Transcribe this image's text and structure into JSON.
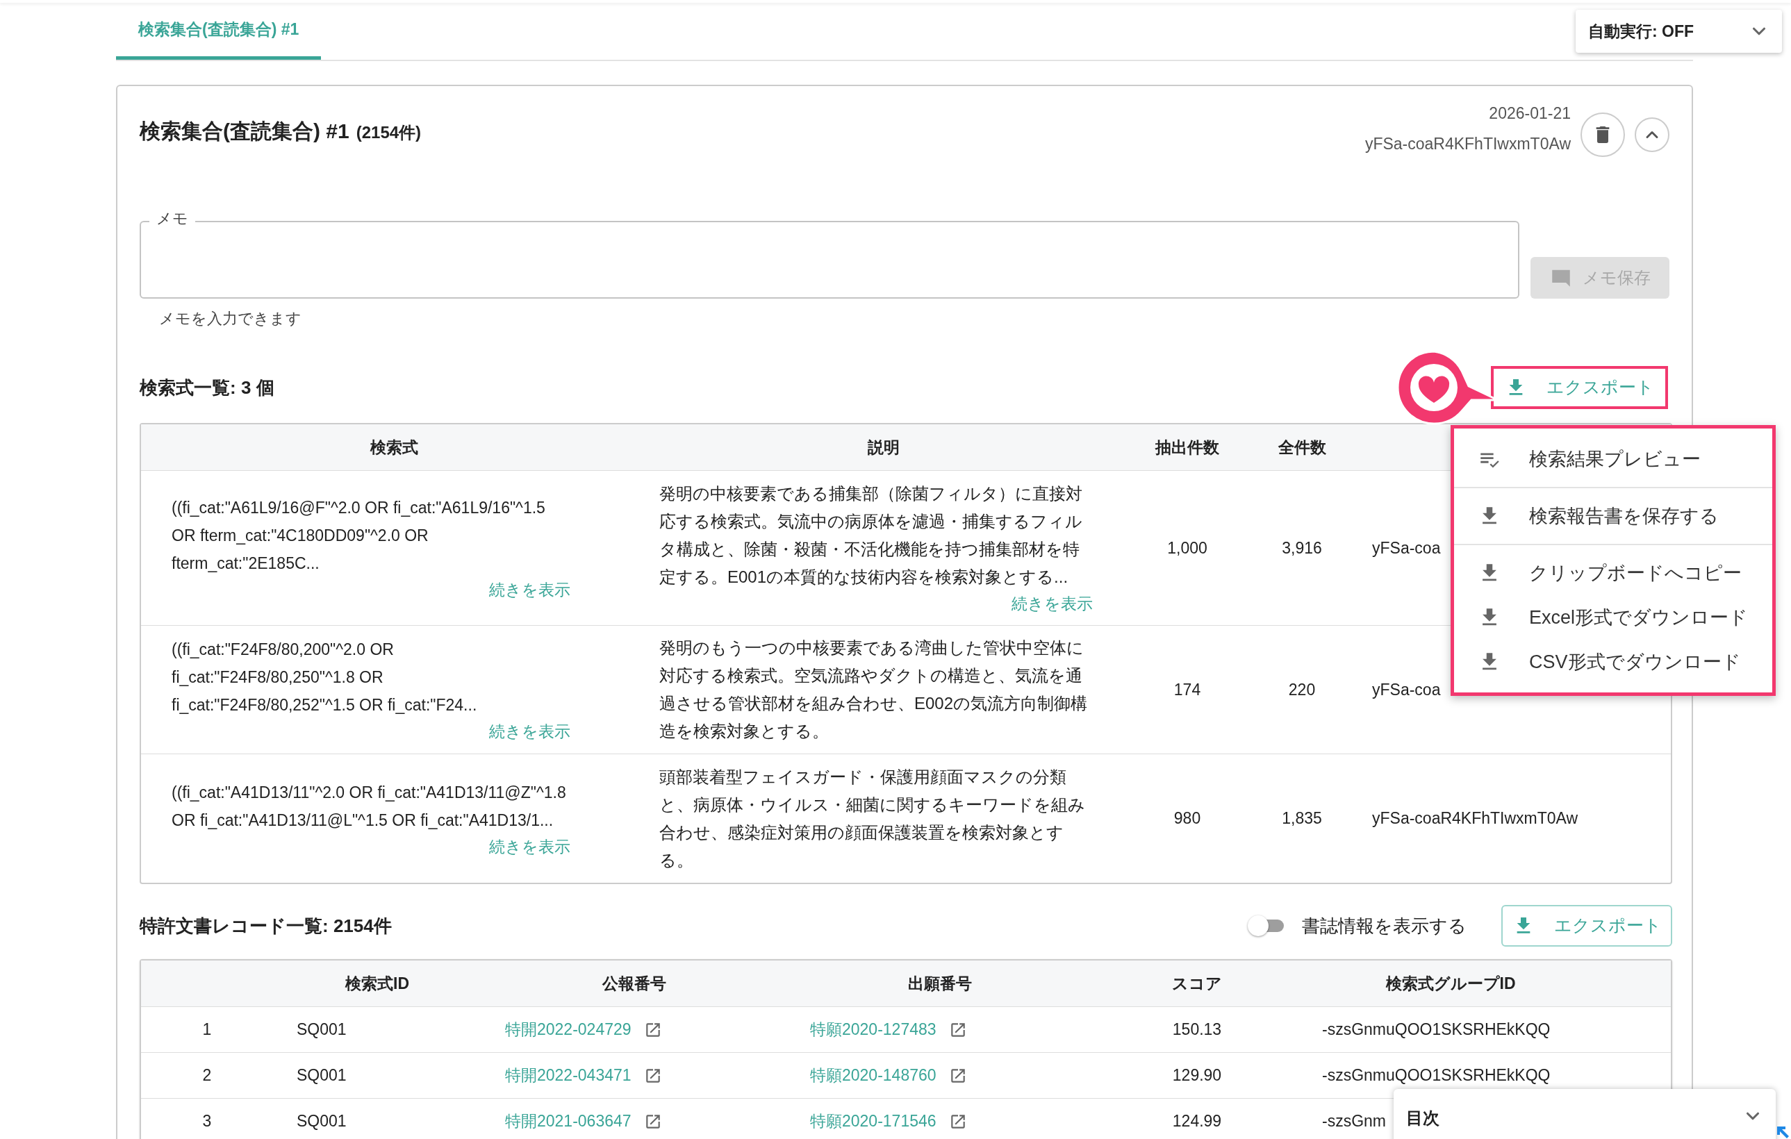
{
  "tabs": [
    {
      "label": "検索集合(査読集合) #1",
      "selected": true
    }
  ],
  "auto_run": {
    "label": "自動実行: OFF",
    "expanded": false
  },
  "card": {
    "title": "検索集合(査読集合) #1",
    "count": "(2154件)",
    "date": "2026-01-21",
    "id": "yFSa-coaR4KFhTIwxmT0Aw",
    "expanded": true
  },
  "memo": {
    "label": "メモ",
    "helper": "メモを入力できます",
    "save_button": "メモ保存",
    "save_disabled": true
  },
  "queries": {
    "heading": "検索式一覧: 3 個",
    "export_button": "エクスポート",
    "columns": [
      "検索式",
      "説明",
      "抽出件数",
      "全件数"
    ],
    "rows": [
      {
        "query": "((fi_cat:\"A61L9/16@F\"^2.0 OR fi_cat:\"A61L9/16\"^1.5 OR fterm_cat:\"4C180DD09\"^2.0 OR fterm_cat:\"2E185C...",
        "query_more": "続きを表示",
        "description": "発明の中核要素である捕集部（除菌フィルタ）に直接対応する検索式。気流中の病原体を濾過・捕集するフィルタ構成と、除菌・殺菌・不活化機能を持つ捕集部材を特定する。E001の本質的な技術内容を検索対象とする...",
        "description_more": "続きを表示",
        "extracted": "1,000",
        "total": "3,916",
        "group": "yFSa-coa"
      },
      {
        "query": "((fi_cat:\"F24F8/80,200\"^2.0 OR fi_cat:\"F24F8/80,250\"^1.8 OR fi_cat:\"F24F8/80,252\"^1.5 OR fi_cat:\"F24...",
        "query_more": "続きを表示",
        "description": "発明のもう一つの中核要素である湾曲した管状中空体に対応する検索式。空気流路やダクトの構造と、気流を通過させる管状部材を組み合わせ、E002の気流方向制御構造を検索対象とする。",
        "extracted": "174",
        "total": "220",
        "group": "yFSa-coa"
      },
      {
        "query": "((fi_cat:\"A41D13/11\"^2.0 OR fi_cat:\"A41D13/11@Z\"^1.8 OR fi_cat:\"A41D13/11@L\"^1.5 OR fi_cat:\"A41D13/1...",
        "query_more": "続きを表示",
        "description": "頭部装着型フェイスガード・保護用顔面マスクの分類と、病原体・ウイルス・細菌に関するキーワードを組み合わせ、感染症対策用の顔面保護装置を検索対象とする。",
        "extracted": "980",
        "total": "1,835",
        "group": "yFSa-coaR4KFhTIwxmT0Aw"
      }
    ]
  },
  "export_menu": {
    "groups": [
      [
        {
          "label": "検索結果プレビュー",
          "kind": "preview"
        }
      ],
      [
        {
          "label": "検索報告書を保存する",
          "kind": "download"
        }
      ],
      [
        {
          "label": "クリップボードへコピー",
          "kind": "download"
        },
        {
          "label": "Excel形式でダウンロード",
          "kind": "download"
        },
        {
          "label": "CSV形式でダウンロード",
          "kind": "download"
        }
      ]
    ]
  },
  "records": {
    "heading": "特許文書レコード一覧: 2154件",
    "show_biblio": {
      "label": "書誌情報を表示する",
      "on": false
    },
    "export_button": "エクスポート",
    "columns": [
      "検索式ID",
      "公報番号",
      "出願番号",
      "スコア",
      "検索式グループID"
    ],
    "rows": [
      {
        "no": "1",
        "query_id": "SQ001",
        "publication": "特開2022-024729",
        "application": "特願2020-127483",
        "score": "150.13",
        "group": "-szsGnmuQOO1SKSRHEkKQQ"
      },
      {
        "no": "2",
        "query_id": "SQ001",
        "publication": "特開2022-043471",
        "application": "特願2020-148760",
        "score": "129.90",
        "group": "-szsGnmuQOO1SKSRHEkKQQ"
      },
      {
        "no": "3",
        "query_id": "SQ001",
        "publication": "特開2021-063647",
        "application": "特願2020-171546",
        "score": "124.99",
        "group": "-szsGnm"
      }
    ]
  },
  "toc": {
    "label": "目次",
    "expanded": false
  }
}
